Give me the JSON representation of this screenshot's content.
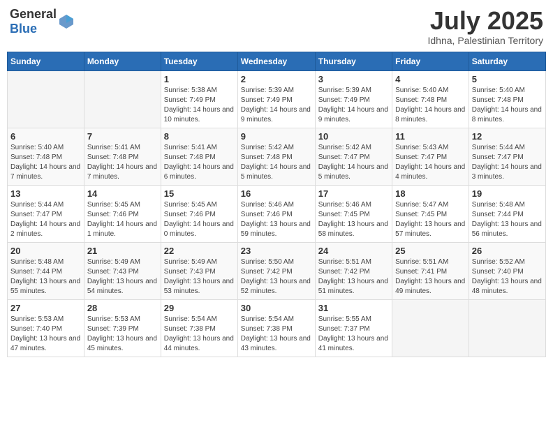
{
  "header": {
    "logo_general": "General",
    "logo_blue": "Blue",
    "title": "July 2025",
    "location": "Idhna, Palestinian Territory"
  },
  "calendar": {
    "days_of_week": [
      "Sunday",
      "Monday",
      "Tuesday",
      "Wednesday",
      "Thursday",
      "Friday",
      "Saturday"
    ],
    "weeks": [
      [
        {
          "day": "",
          "sunrise": "",
          "sunset": "",
          "daylight": ""
        },
        {
          "day": "",
          "sunrise": "",
          "sunset": "",
          "daylight": ""
        },
        {
          "day": "1",
          "sunrise": "Sunrise: 5:38 AM",
          "sunset": "Sunset: 7:49 PM",
          "daylight": "Daylight: 14 hours and 10 minutes."
        },
        {
          "day": "2",
          "sunrise": "Sunrise: 5:39 AM",
          "sunset": "Sunset: 7:49 PM",
          "daylight": "Daylight: 14 hours and 9 minutes."
        },
        {
          "day": "3",
          "sunrise": "Sunrise: 5:39 AM",
          "sunset": "Sunset: 7:49 PM",
          "daylight": "Daylight: 14 hours and 9 minutes."
        },
        {
          "day": "4",
          "sunrise": "Sunrise: 5:40 AM",
          "sunset": "Sunset: 7:48 PM",
          "daylight": "Daylight: 14 hours and 8 minutes."
        },
        {
          "day": "5",
          "sunrise": "Sunrise: 5:40 AM",
          "sunset": "Sunset: 7:48 PM",
          "daylight": "Daylight: 14 hours and 8 minutes."
        }
      ],
      [
        {
          "day": "6",
          "sunrise": "Sunrise: 5:40 AM",
          "sunset": "Sunset: 7:48 PM",
          "daylight": "Daylight: 14 hours and 7 minutes."
        },
        {
          "day": "7",
          "sunrise": "Sunrise: 5:41 AM",
          "sunset": "Sunset: 7:48 PM",
          "daylight": "Daylight: 14 hours and 7 minutes."
        },
        {
          "day": "8",
          "sunrise": "Sunrise: 5:41 AM",
          "sunset": "Sunset: 7:48 PM",
          "daylight": "Daylight: 14 hours and 6 minutes."
        },
        {
          "day": "9",
          "sunrise": "Sunrise: 5:42 AM",
          "sunset": "Sunset: 7:48 PM",
          "daylight": "Daylight: 14 hours and 5 minutes."
        },
        {
          "day": "10",
          "sunrise": "Sunrise: 5:42 AM",
          "sunset": "Sunset: 7:47 PM",
          "daylight": "Daylight: 14 hours and 5 minutes."
        },
        {
          "day": "11",
          "sunrise": "Sunrise: 5:43 AM",
          "sunset": "Sunset: 7:47 PM",
          "daylight": "Daylight: 14 hours and 4 minutes."
        },
        {
          "day": "12",
          "sunrise": "Sunrise: 5:44 AM",
          "sunset": "Sunset: 7:47 PM",
          "daylight": "Daylight: 14 hours and 3 minutes."
        }
      ],
      [
        {
          "day": "13",
          "sunrise": "Sunrise: 5:44 AM",
          "sunset": "Sunset: 7:47 PM",
          "daylight": "Daylight: 14 hours and 2 minutes."
        },
        {
          "day": "14",
          "sunrise": "Sunrise: 5:45 AM",
          "sunset": "Sunset: 7:46 PM",
          "daylight": "Daylight: 14 hours and 1 minute."
        },
        {
          "day": "15",
          "sunrise": "Sunrise: 5:45 AM",
          "sunset": "Sunset: 7:46 PM",
          "daylight": "Daylight: 14 hours and 0 minutes."
        },
        {
          "day": "16",
          "sunrise": "Sunrise: 5:46 AM",
          "sunset": "Sunset: 7:46 PM",
          "daylight": "Daylight: 13 hours and 59 minutes."
        },
        {
          "day": "17",
          "sunrise": "Sunrise: 5:46 AM",
          "sunset": "Sunset: 7:45 PM",
          "daylight": "Daylight: 13 hours and 58 minutes."
        },
        {
          "day": "18",
          "sunrise": "Sunrise: 5:47 AM",
          "sunset": "Sunset: 7:45 PM",
          "daylight": "Daylight: 13 hours and 57 minutes."
        },
        {
          "day": "19",
          "sunrise": "Sunrise: 5:48 AM",
          "sunset": "Sunset: 7:44 PM",
          "daylight": "Daylight: 13 hours and 56 minutes."
        }
      ],
      [
        {
          "day": "20",
          "sunrise": "Sunrise: 5:48 AM",
          "sunset": "Sunset: 7:44 PM",
          "daylight": "Daylight: 13 hours and 55 minutes."
        },
        {
          "day": "21",
          "sunrise": "Sunrise: 5:49 AM",
          "sunset": "Sunset: 7:43 PM",
          "daylight": "Daylight: 13 hours and 54 minutes."
        },
        {
          "day": "22",
          "sunrise": "Sunrise: 5:49 AM",
          "sunset": "Sunset: 7:43 PM",
          "daylight": "Daylight: 13 hours and 53 minutes."
        },
        {
          "day": "23",
          "sunrise": "Sunrise: 5:50 AM",
          "sunset": "Sunset: 7:42 PM",
          "daylight": "Daylight: 13 hours and 52 minutes."
        },
        {
          "day": "24",
          "sunrise": "Sunrise: 5:51 AM",
          "sunset": "Sunset: 7:42 PM",
          "daylight": "Daylight: 13 hours and 51 minutes."
        },
        {
          "day": "25",
          "sunrise": "Sunrise: 5:51 AM",
          "sunset": "Sunset: 7:41 PM",
          "daylight": "Daylight: 13 hours and 49 minutes."
        },
        {
          "day": "26",
          "sunrise": "Sunrise: 5:52 AM",
          "sunset": "Sunset: 7:40 PM",
          "daylight": "Daylight: 13 hours and 48 minutes."
        }
      ],
      [
        {
          "day": "27",
          "sunrise": "Sunrise: 5:53 AM",
          "sunset": "Sunset: 7:40 PM",
          "daylight": "Daylight: 13 hours and 47 minutes."
        },
        {
          "day": "28",
          "sunrise": "Sunrise: 5:53 AM",
          "sunset": "Sunset: 7:39 PM",
          "daylight": "Daylight: 13 hours and 45 minutes."
        },
        {
          "day": "29",
          "sunrise": "Sunrise: 5:54 AM",
          "sunset": "Sunset: 7:38 PM",
          "daylight": "Daylight: 13 hours and 44 minutes."
        },
        {
          "day": "30",
          "sunrise": "Sunrise: 5:54 AM",
          "sunset": "Sunset: 7:38 PM",
          "daylight": "Daylight: 13 hours and 43 minutes."
        },
        {
          "day": "31",
          "sunrise": "Sunrise: 5:55 AM",
          "sunset": "Sunset: 7:37 PM",
          "daylight": "Daylight: 13 hours and 41 minutes."
        },
        {
          "day": "",
          "sunrise": "",
          "sunset": "",
          "daylight": ""
        },
        {
          "day": "",
          "sunrise": "",
          "sunset": "",
          "daylight": ""
        }
      ]
    ]
  }
}
